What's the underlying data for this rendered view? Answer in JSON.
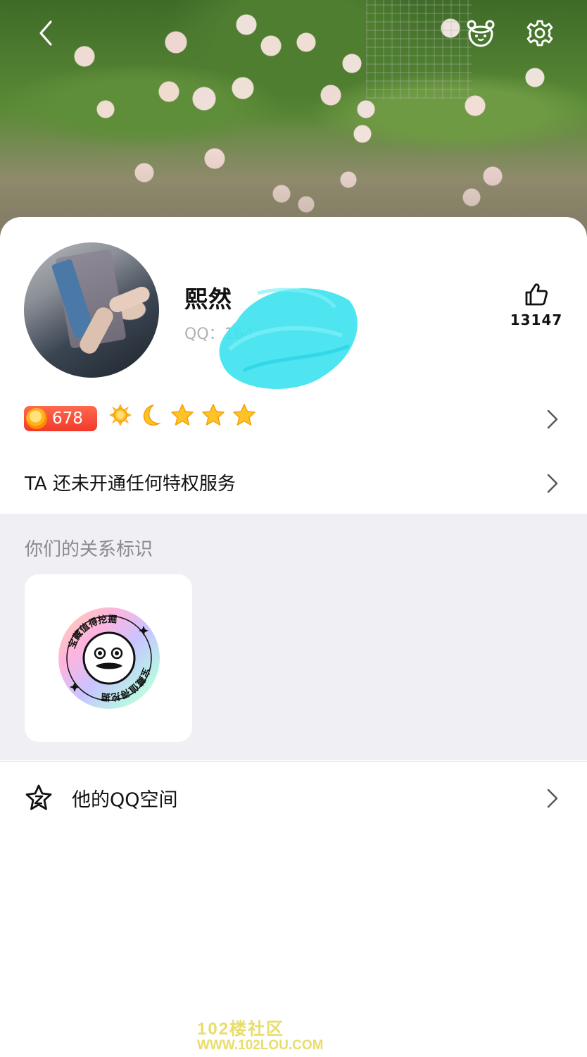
{
  "header": {
    "back_icon": "chevron-left-icon",
    "bear_icon": "bear-face-icon",
    "settings_icon": "gear-icon"
  },
  "profile": {
    "nickname": "熙然",
    "qq_label": "QQ：164",
    "likes": "13147",
    "like_icon": "thumbs-up-icon"
  },
  "level": {
    "value": "678",
    "icons": [
      "sun-icon",
      "moon-icon",
      "star-icon",
      "star-icon",
      "star-icon"
    ]
  },
  "privilege": {
    "text": "TA 还未开通任何特权服务"
  },
  "relation": {
    "title": "你们的关系标识",
    "badge_text": "宝藏值得挖掘"
  },
  "qzone": {
    "label": "他的QQ空间",
    "icon": "qzone-star-icon"
  },
  "watermark": {
    "line1": "102楼社区",
    "line2": "WWW.102LOU.COM"
  },
  "colors": {
    "level_badge": "#f2392a",
    "section_bg": "#efeff4",
    "censor": "#3fe3f0",
    "watermark": "#e8dd6a"
  }
}
